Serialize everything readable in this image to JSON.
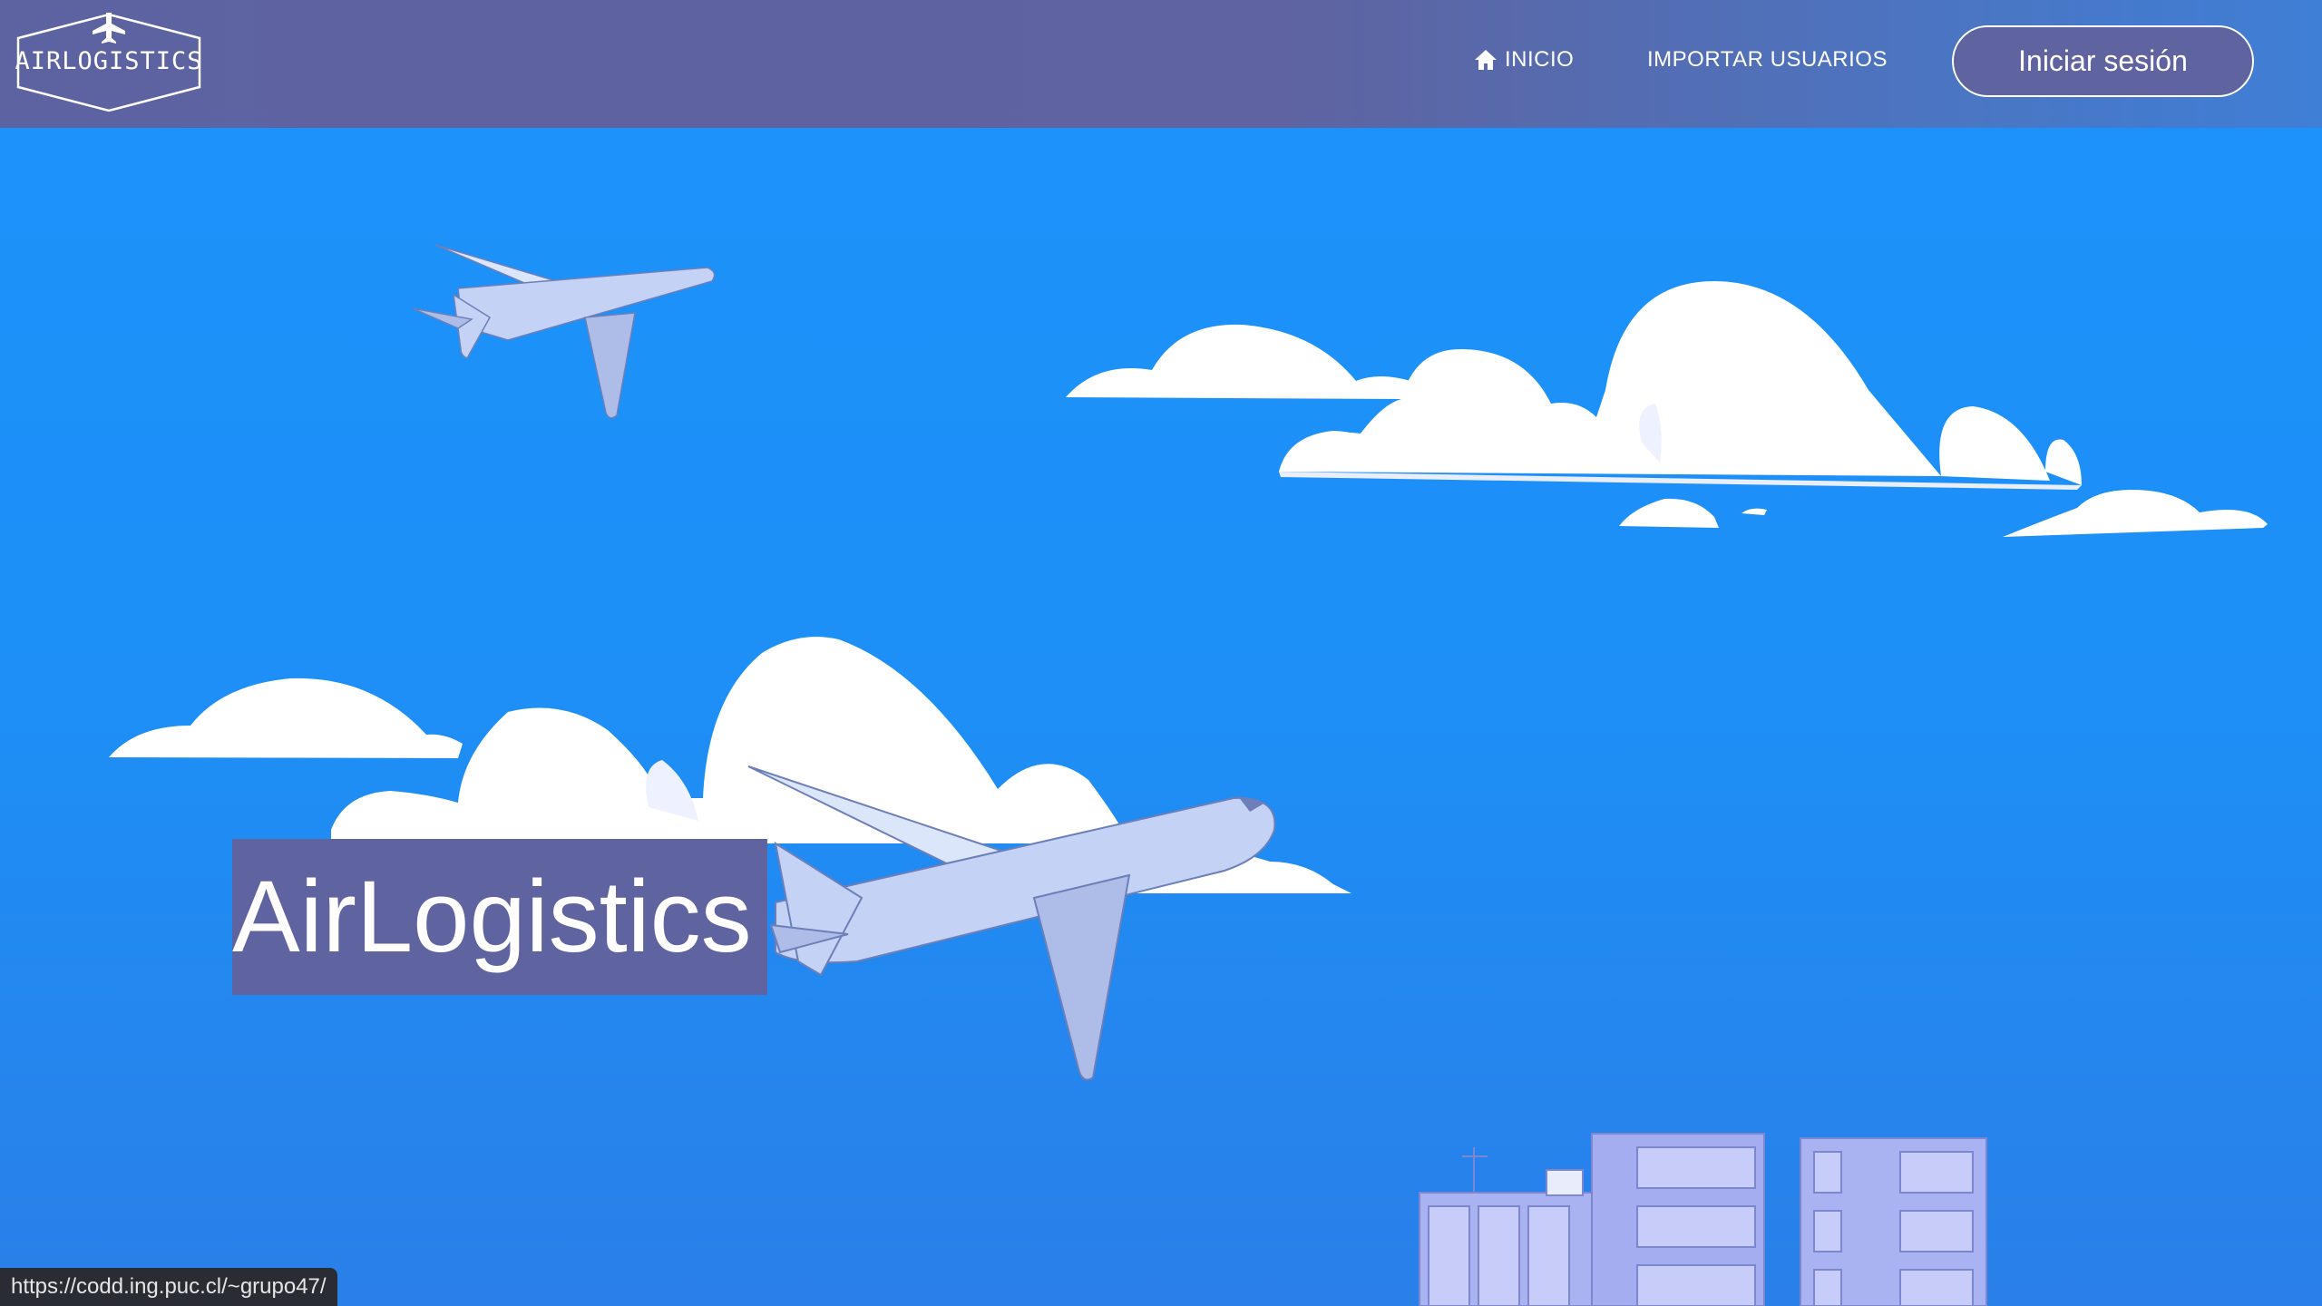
{
  "navbar": {
    "logo_text": "AIRLOGISTICS",
    "links": [
      {
        "label": "INICIO",
        "icon": "home-icon"
      },
      {
        "label": "IMPORTAR USUARIOS"
      }
    ],
    "login_label": "Iniciar sesión"
  },
  "hero": {
    "title": "AirLogistics"
  },
  "status_bar": {
    "url": "https://codd.ing.puc.cl/~grupo47/"
  },
  "colors": {
    "navbar": "#5f639f",
    "sky": "#1b93fb",
    "cloud": "#ffffff",
    "plane": "#b9c9f2",
    "building": "#9aa6ee"
  }
}
